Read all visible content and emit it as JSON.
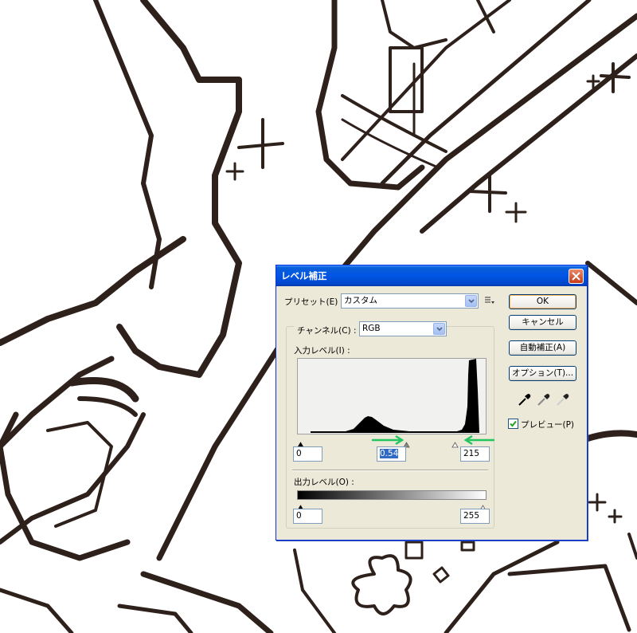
{
  "dialog": {
    "title": "レベル補正",
    "preset_label": "プリセット(E) :",
    "preset_value": "カスタム",
    "channel_label": "チャンネル(C) :",
    "channel_value": "RGB",
    "input_levels_label": "入力レベル(I) :",
    "input_black": "0",
    "input_gamma": "0.54",
    "input_white": "215",
    "output_levels_label": "出力レベル(O) :",
    "output_black": "0",
    "output_white": "255",
    "buttons": {
      "ok": "OK",
      "cancel": "キャンセル",
      "auto": "自動補正(A)",
      "options": "オプション(T)..."
    },
    "preview_label": "プレビュー(P)",
    "preview_checked": true
  },
  "colors": {
    "title_bar": "#0055e5",
    "dialog_bg": "#ece9d8",
    "annotation_arrow": "#22c55e",
    "ink": "#2e201b"
  },
  "icons": [
    "close-icon",
    "preset-menu-icon",
    "black-eyedropper-icon",
    "gray-eyedropper-icon",
    "white-eyedropper-icon",
    "checkmark-icon"
  ]
}
